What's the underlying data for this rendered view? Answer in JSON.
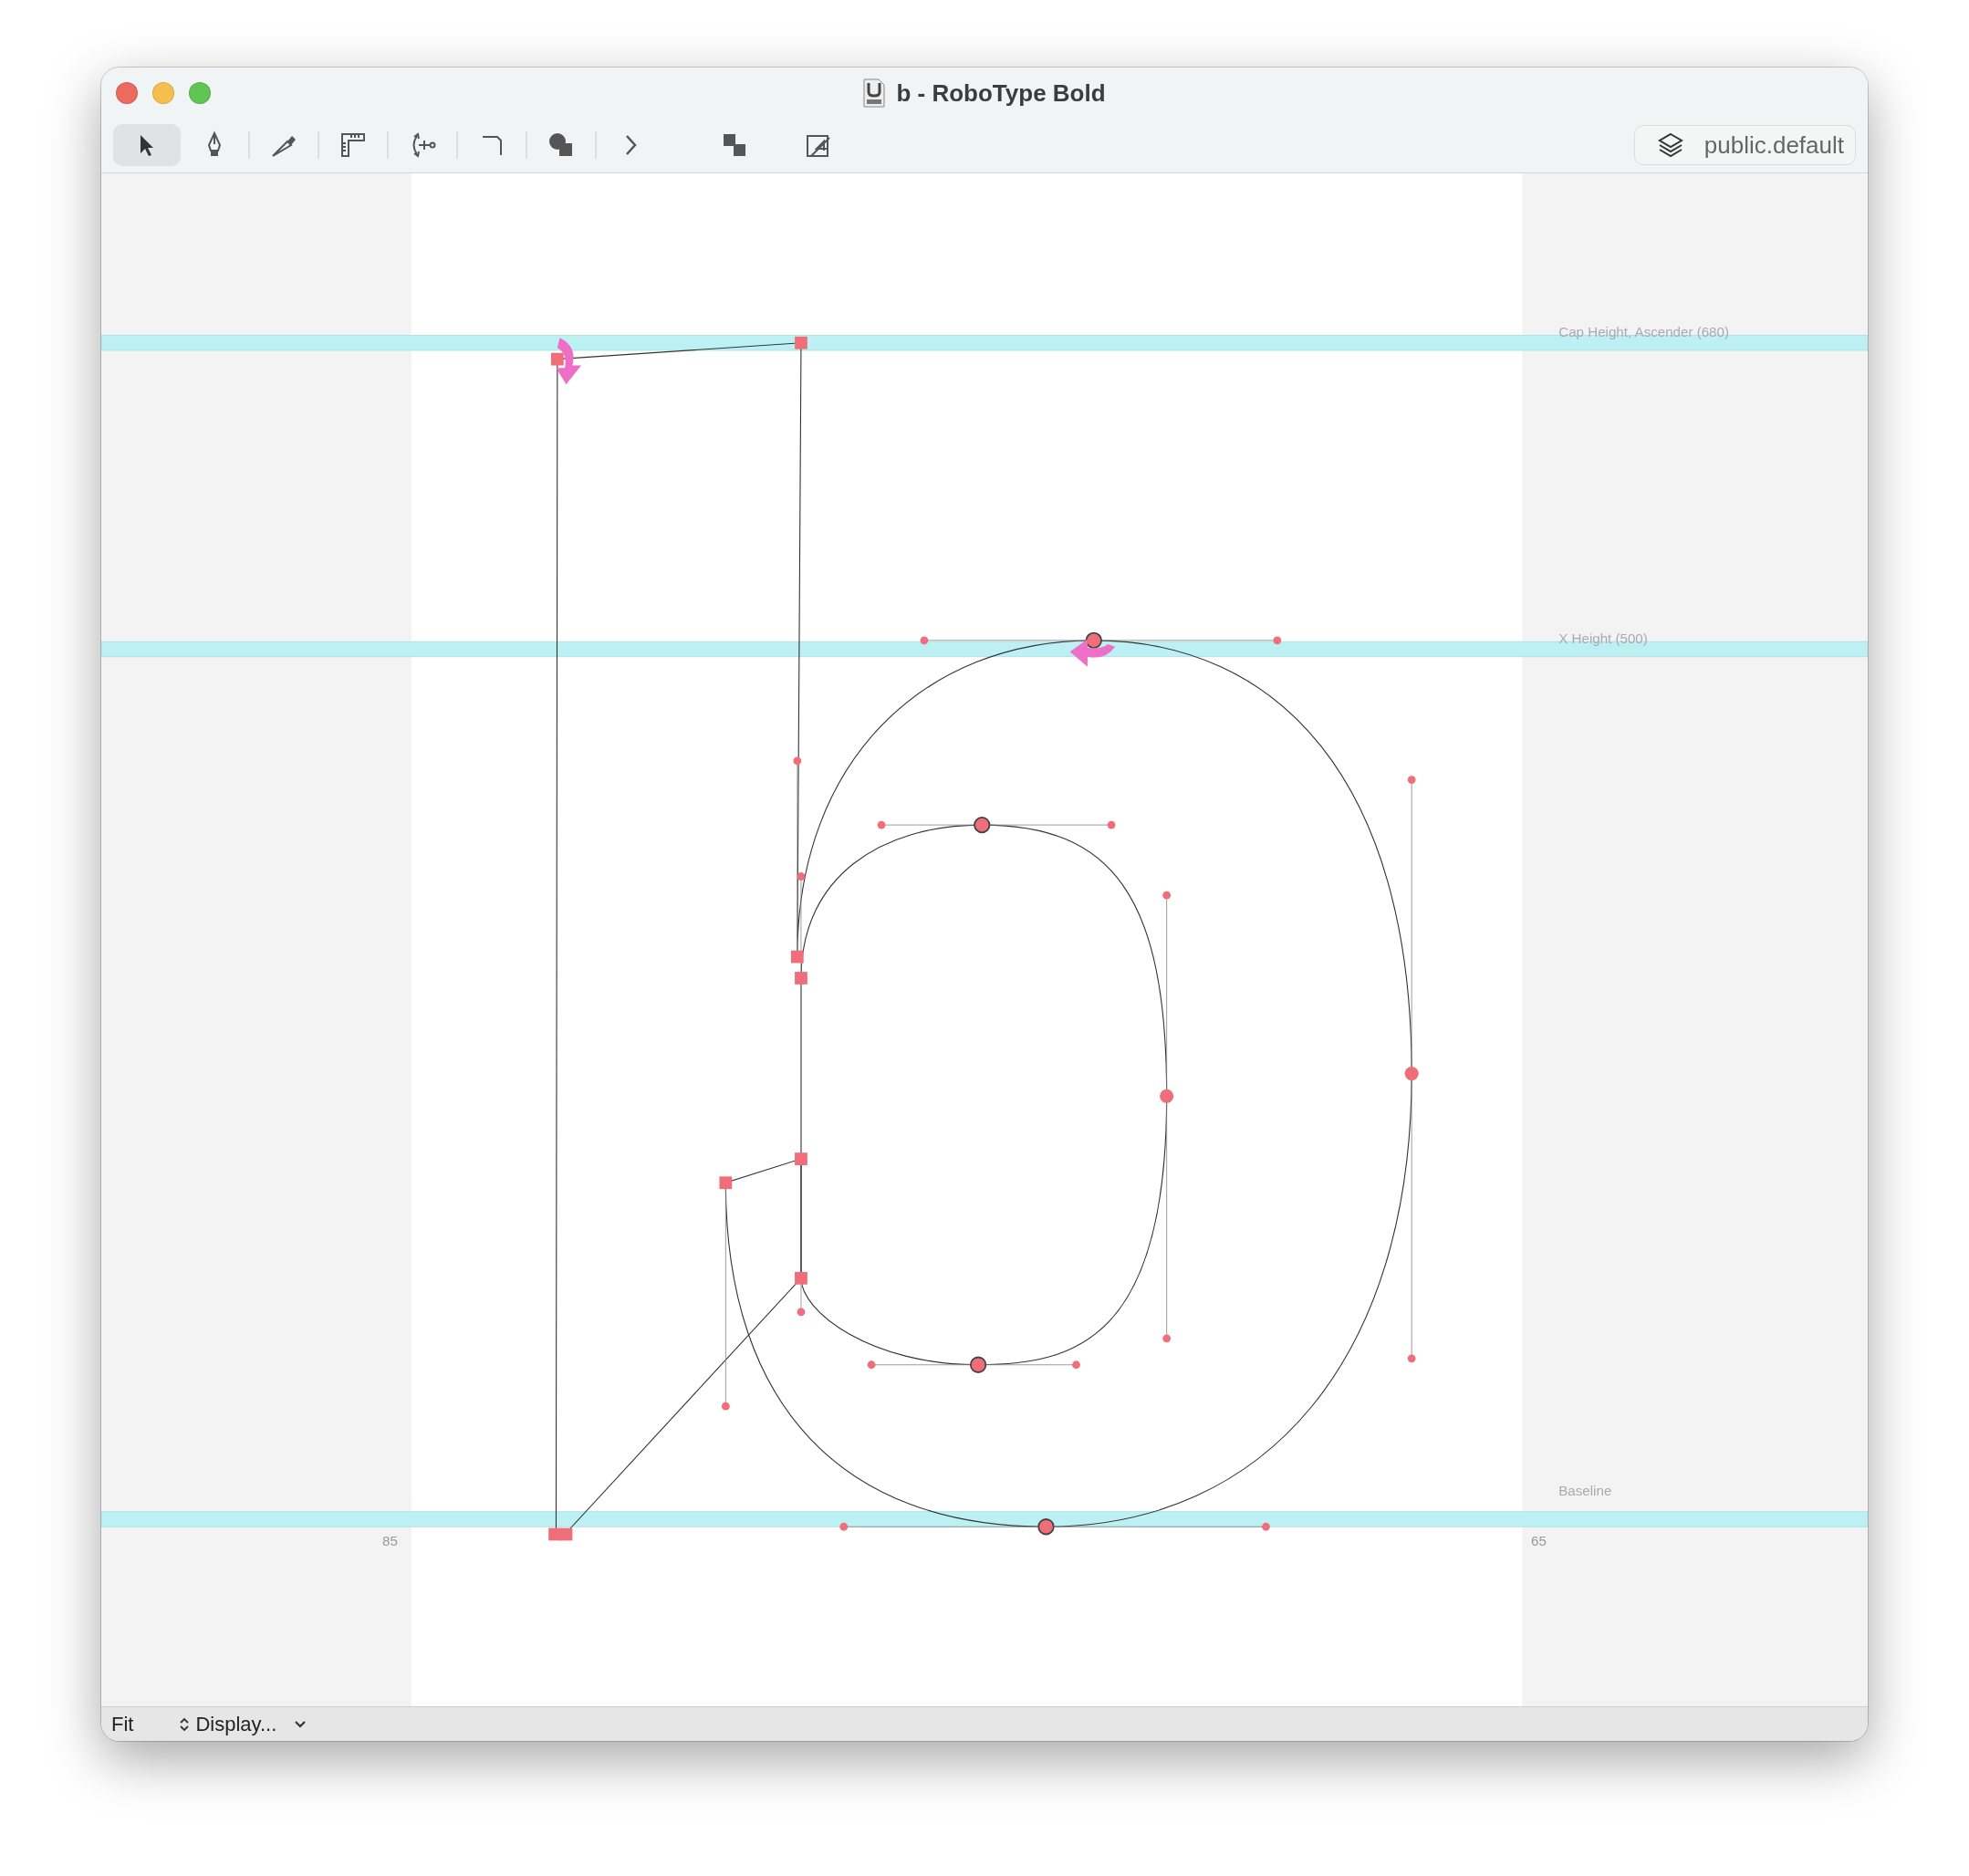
{
  "window": {
    "title": "b - RoboType Bold"
  },
  "toolbar": {
    "tools": [
      {
        "kind": "pointer",
        "selected": true
      },
      {
        "kind": "pen",
        "selected": false
      },
      {
        "kind": "knife",
        "selected": false
      },
      {
        "kind": "ruler",
        "selected": false
      },
      {
        "kind": "anchor",
        "selected": false
      },
      {
        "kind": "corner",
        "selected": false
      },
      {
        "kind": "shapes",
        "selected": false
      },
      {
        "kind": "chevron",
        "selected": false
      }
    ],
    "actions": [
      {
        "kind": "overlap"
      },
      {
        "kind": "number"
      }
    ],
    "layer_button": {
      "label": "public.default"
    }
  },
  "canvas": {
    "guides": [
      {
        "kind": "cap",
        "label": "Cap Height, Ascender (680)"
      },
      {
        "kind": "xheight",
        "label": "X Height (500)"
      },
      {
        "kind": "baseline",
        "label": "Baseline"
      }
    ],
    "left_sidebearing": "85",
    "right_sidebearing": "65"
  },
  "status_bar": {
    "zoom": "Fit",
    "display_menu": "Display..."
  }
}
